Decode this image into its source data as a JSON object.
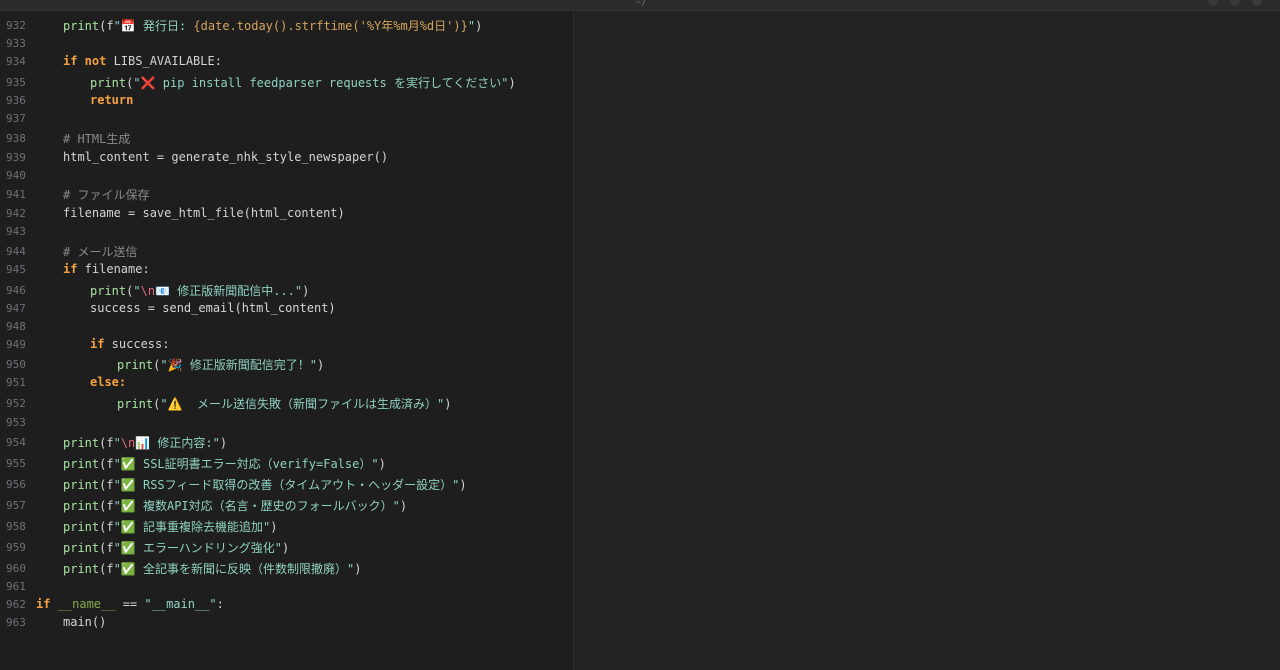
{
  "window": {
    "title_mark": "~/"
  },
  "editor": {
    "lines": [
      {
        "num": "932",
        "text": "print(f\"📅 発行日: {date.today().strftime('%Y年%m月%d日')}\")"
      },
      {
        "num": "933",
        "text": ""
      },
      {
        "num": "934",
        "text": "if not LIBS_AVAILABLE:"
      },
      {
        "num": "935",
        "text": "print(\"❌ pip install feedparser requests を実行してください\")"
      },
      {
        "num": "936",
        "text": "return"
      },
      {
        "num": "937",
        "text": ""
      },
      {
        "num": "938",
        "text": "# HTML生成"
      },
      {
        "num": "939",
        "text": "html_content = generate_nhk_style_newspaper()"
      },
      {
        "num": "940",
        "text": ""
      },
      {
        "num": "941",
        "text": "# ファイル保存"
      },
      {
        "num": "942",
        "text": "filename = save_html_file(html_content)"
      },
      {
        "num": "943",
        "text": ""
      },
      {
        "num": "944",
        "text": "# メール送信"
      },
      {
        "num": "945",
        "text": "if filename:"
      },
      {
        "num": "946",
        "text": "print(\"\\n📧 修正版新聞配信中...\")"
      },
      {
        "num": "947",
        "text": "success = send_email(html_content)"
      },
      {
        "num": "948",
        "text": ""
      },
      {
        "num": "949",
        "text": "if success:"
      },
      {
        "num": "950",
        "text": "print(\"🎉 修正版新聞配信完了！\")"
      },
      {
        "num": "951",
        "text": "else:"
      },
      {
        "num": "952",
        "text": "print(\"⚠️  メール送信失敗（新聞ファイルは生成済み）\")"
      },
      {
        "num": "953",
        "text": ""
      },
      {
        "num": "954",
        "text": "print(f\"\\n📊 修正内容:\")"
      },
      {
        "num": "955",
        "text": "print(f\"✅ SSL証明書エラー対応（verify=False）\")"
      },
      {
        "num": "956",
        "text": "print(f\"✅ RSSフィード取得の改善（タイムアウト・ヘッダー設定）\")"
      },
      {
        "num": "957",
        "text": "print(f\"✅ 複数API対応（名言・歴史のフォールバック）\")"
      },
      {
        "num": "958",
        "text": "print(f\"✅ 記事重複除去機能追加\")"
      },
      {
        "num": "959",
        "text": "print(f\"✅ エラーハンドリング強化\")"
      },
      {
        "num": "960",
        "text": "print(f\"✅ 全記事を新聞に反映（件数制限撤廃）\")"
      },
      {
        "num": "961",
        "text": ""
      },
      {
        "num": "962",
        "text": "if __name__ == \"__main__\":"
      },
      {
        "num": "963",
        "text": "main()"
      }
    ]
  }
}
